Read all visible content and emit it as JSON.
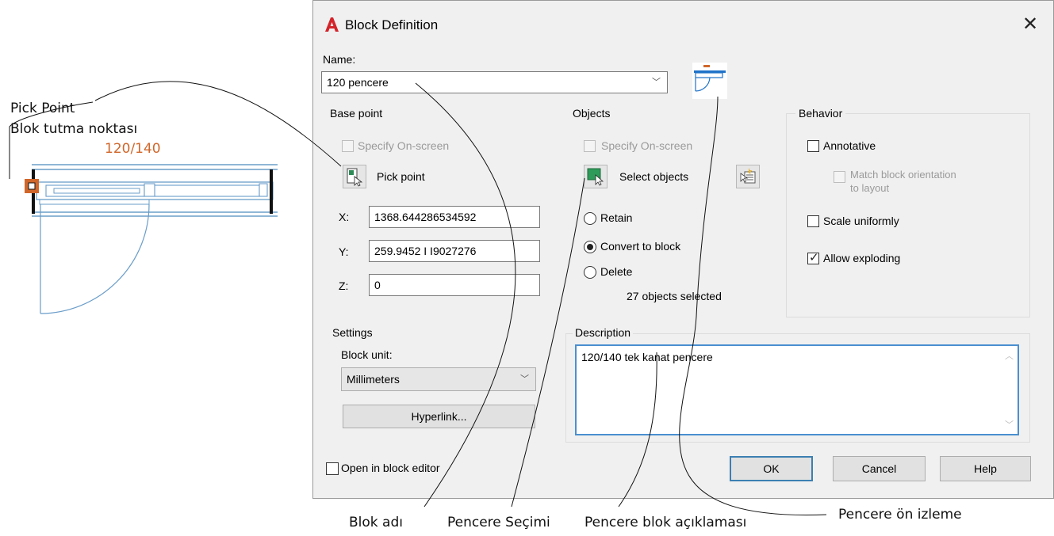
{
  "annotations": {
    "pick_point": "Pick Point",
    "blok_tutma": "Blok tutma noktası",
    "dim": "120/140",
    "blok_adi": "Blok adı",
    "pencere_secimi": "Pencere Seçimi",
    "pencere_aciklama": "Pencere blok açıklaması",
    "pencere_onizleme": "Pencere ön izleme"
  },
  "dialog": {
    "title": "Block Definition",
    "name_label": "Name:",
    "name_value": "120 pencere",
    "base_point": {
      "title": "Base point",
      "specify": "Specify On-screen",
      "pick_label": "Pick point",
      "x_label": "X:",
      "x_value": "1368.644286534592",
      "y_label": "Y:",
      "y_value": "259.9452 I I9027276",
      "z_label": "Z:",
      "z_value": "0"
    },
    "objects": {
      "title": "Objects",
      "specify": "Specify On-screen",
      "select_label": "Select objects",
      "retain": "Retain",
      "convert": "Convert to block",
      "delete": "Delete",
      "count": "27 objects selected"
    },
    "behavior": {
      "title": "Behavior",
      "annotative": "Annotative",
      "match_line1": "Match block orientation",
      "match_line2": "to layout",
      "scale": "Scale uniformly",
      "explode": "Allow exploding"
    },
    "settings": {
      "title": "Settings",
      "unit_label": "Block unit:",
      "unit_value": "Millimeters",
      "hyperlink": "Hyperlink..."
    },
    "description": {
      "title": "Description",
      "value": "120/140 tek kanat pencere"
    },
    "open_editor": "Open in block editor",
    "ok": "OK",
    "cancel": "Cancel",
    "help": "Help"
  },
  "colors": {
    "accent": "#d0662a",
    "app_logo": "#d4232a",
    "window_line": "#6a9dc9"
  }
}
